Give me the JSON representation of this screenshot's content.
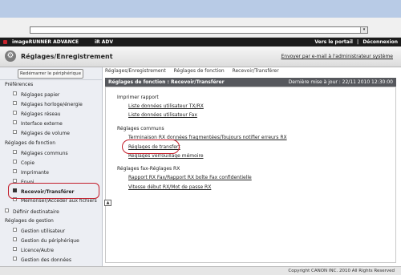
{
  "browser": {
    "dropdown_arrow": "▾"
  },
  "product_bar": {
    "product_name": "imageRUNNER ADVANCE",
    "model": "iR ADV",
    "portal_link": "Vers le portail",
    "separator": "|",
    "logout_link": "Déconnexion"
  },
  "title_bar": {
    "title": "Réglages/Enregistrement",
    "mail_link": "Envoyer par e-mail à l'administrateur système"
  },
  "sidebar": {
    "restart_button": "Redémarrer le périphérique",
    "sections": [
      {
        "label": "Préférences",
        "items": [
          "Réglages papier",
          "Réglages horloge/énergie",
          "Réglages réseau",
          "Interface externe",
          "Réglages de volume"
        ]
      },
      {
        "label": "Réglages de fonction",
        "items": [
          "Réglages communs",
          "Copie",
          "Imprimante",
          "Envoi",
          "Recevoir/Transférer",
          "Mémoriser/Accéder aux fichiers"
        ]
      },
      {
        "label": "Définir destinataire",
        "items": []
      },
      {
        "label": "Réglages de gestion",
        "items": [
          "Gestion utilisateur",
          "Gestion du périphérique",
          "Licence/Autre",
          "Gestion des données"
        ]
      }
    ]
  },
  "main": {
    "breadcrumb": [
      "Réglages/Enregistrement",
      "Réglages de fonction",
      "Recevoir/Transférer"
    ],
    "panel_title": "Réglages de fonction : Recevoir/Transférer",
    "last_update": "Dernière mise à jour : 22/11 2010 12:30:00",
    "groups": [
      {
        "label": "Imprimer rapport",
        "links": [
          "Liste données utilisateur TX/RX",
          "Liste données utilisateur Fax"
        ]
      },
      {
        "label": "Réglages communs",
        "links": [
          "Terminaison RX données fragmentées/Toujours notifier erreurs RX",
          "Réglages de transfert",
          "Réglages verrouillage mémoire"
        ]
      },
      {
        "label": "Réglages fax-Réglages RX",
        "links": [
          "Rapport RX Fax/Rapport RX boîte Fax confidentielle",
          "Vitesse début RX/Mot de passe RX"
        ]
      }
    ],
    "to_top": "▲"
  },
  "footer": {
    "copyright": "Copyright CANON INC. 2010 All Rights Reserved"
  },
  "colors": {
    "highlight_circle": "#c31d2a",
    "panel_header": "#56585d",
    "product_bar": "#1c1c1c"
  }
}
